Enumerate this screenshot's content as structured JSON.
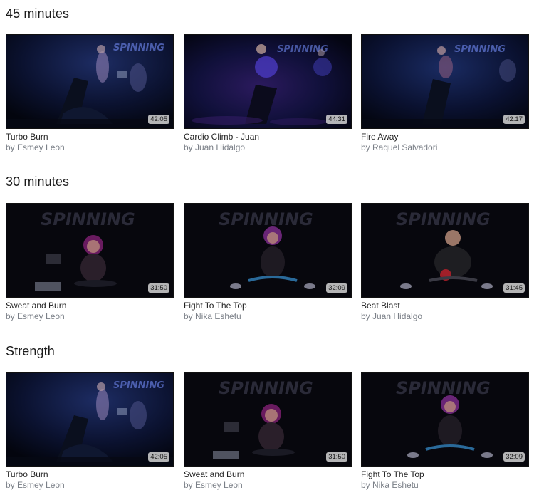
{
  "sections": [
    {
      "title": "45 minutes",
      "videos": [
        {
          "title": "Turbo Burn",
          "author": "by Esmey Leon",
          "duration": "42:05"
        },
        {
          "title": "Cardio Climb - Juan",
          "author": "by Juan Hidalgo",
          "duration": "44:31"
        },
        {
          "title": "Fire Away",
          "author": "by Raquel Salvadori",
          "duration": "42:17"
        }
      ]
    },
    {
      "title": "30 minutes",
      "videos": [
        {
          "title": "Sweat and Burn",
          "author": "by Esmey Leon",
          "duration": "31:50"
        },
        {
          "title": "Fight To The Top",
          "author": "by Nika Eshetu",
          "duration": "32:09"
        },
        {
          "title": "Beat Blast",
          "author": "by Juan Hidalgo",
          "duration": "31:45"
        }
      ]
    },
    {
      "title": "Strength",
      "videos": [
        {
          "title": "Turbo Burn",
          "author": "by Esmey Leon",
          "duration": "42:05"
        },
        {
          "title": "Sweat and Burn",
          "author": "by Esmey Leon",
          "duration": "31:50"
        },
        {
          "title": "Fight To The Top",
          "author": "by Nika Eshetu",
          "duration": "32:09"
        }
      ]
    }
  ],
  "thumbnail_logo_text": "SPINNING",
  "colors": {
    "section_title": "#1b1b1b",
    "video_title": "#1f1f1f",
    "author": "#7a7f87",
    "duration_bg": "#cdcdcd"
  }
}
